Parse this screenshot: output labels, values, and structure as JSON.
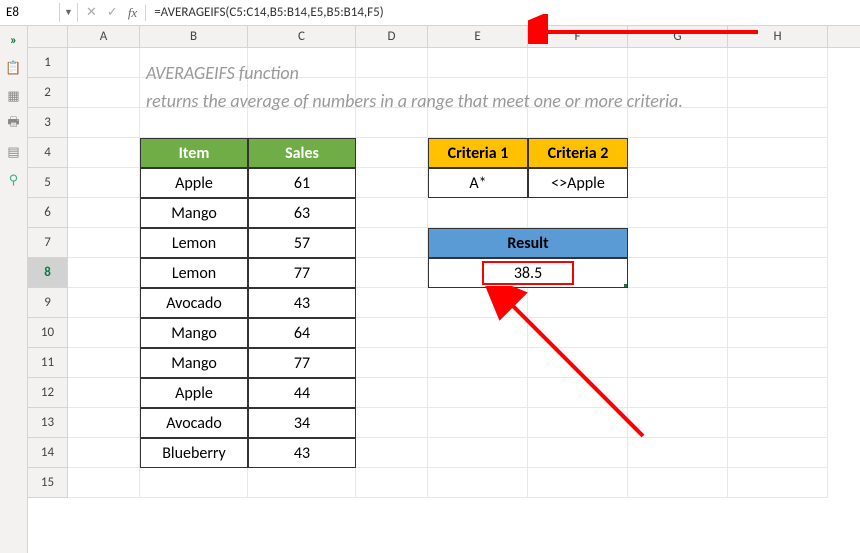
{
  "name_box": "E8",
  "formula": "=AVERAGEIFS(C5:C14,B5:B14,E5,B5:B14,F5)",
  "columns": [
    "A",
    "B",
    "C",
    "D",
    "E",
    "F",
    "G",
    "H"
  ],
  "desc1": "AVERAGEIFS function",
  "desc2": "returns the average of numbers in a range that meet one or more criteria.",
  "table": {
    "header_item": "Item",
    "header_sales": "Sales",
    "rows": [
      {
        "item": "Apple",
        "sales": 61
      },
      {
        "item": "Mango",
        "sales": 63
      },
      {
        "item": "Lemon",
        "sales": 57
      },
      {
        "item": "Lemon",
        "sales": 77
      },
      {
        "item": "Avocado",
        "sales": 43
      },
      {
        "item": "Mango",
        "sales": 64
      },
      {
        "item": "Mango",
        "sales": 77
      },
      {
        "item": "Apple",
        "sales": 44
      },
      {
        "item": "Avocado",
        "sales": 34
      },
      {
        "item": "Blueberry",
        "sales": 43
      }
    ]
  },
  "criteria": {
    "h1": "Criteria 1",
    "h2": "Criteria 2",
    "v1": "A*",
    "v2": "<>Apple"
  },
  "result": {
    "label": "Result",
    "value": 38.5
  },
  "chart_data": {
    "type": "table",
    "title": "AVERAGEIFS function example",
    "columns": [
      "Item",
      "Sales"
    ],
    "rows": [
      [
        "Apple",
        61
      ],
      [
        "Mango",
        63
      ],
      [
        "Lemon",
        57
      ],
      [
        "Lemon",
        77
      ],
      [
        "Avocado",
        43
      ],
      [
        "Mango",
        64
      ],
      [
        "Mango",
        77
      ],
      [
        "Apple",
        44
      ],
      [
        "Avocado",
        34
      ],
      [
        "Blueberry",
        43
      ]
    ],
    "criteria": {
      "Criteria 1": "A*",
      "Criteria 2": "<>Apple"
    },
    "result": 38.5,
    "formula": "=AVERAGEIFS(C5:C14,B5:B14,E5,B5:B14,F5)"
  }
}
